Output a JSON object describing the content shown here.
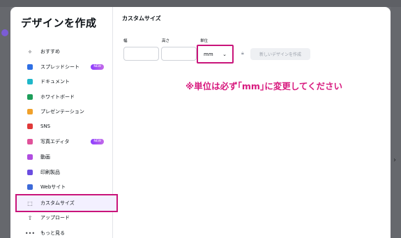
{
  "modal": {
    "title": "デザインを作成",
    "close_icon": "x-icon"
  },
  "sidebar": {
    "items": [
      {
        "label": "おすすめ",
        "icon": "sparkle-icon",
        "color": "#3b3d43"
      },
      {
        "label": "スプレッドシート",
        "icon": "spreadsheet-icon",
        "color": "#2f6fe4",
        "badge": "NEW"
      },
      {
        "label": "ドキュメント",
        "icon": "document-icon",
        "color": "#1fb7c9"
      },
      {
        "label": "ホワイトボード",
        "icon": "whiteboard-icon",
        "color": "#1e9e5a"
      },
      {
        "label": "プレゼンテーション",
        "icon": "presentation-icon",
        "color": "#f0a12b"
      },
      {
        "label": "SNS",
        "icon": "sns-icon",
        "color": "#e03a3a"
      },
      {
        "label": "写真エディタ",
        "icon": "photo-editor-icon",
        "color": "#e0529a",
        "badge": "NEW"
      },
      {
        "label": "動画",
        "icon": "video-icon",
        "color": "#b04de0"
      },
      {
        "label": "印刷製品",
        "icon": "print-icon",
        "color": "#6b4de0"
      },
      {
        "label": "Webサイト",
        "icon": "website-icon",
        "color": "#3d6ad8"
      },
      {
        "label": "カスタムサイズ",
        "icon": "custom-size-icon",
        "color": "#3b3d43"
      },
      {
        "label": "アップロード",
        "icon": "upload-icon",
        "color": "#3b3d43"
      },
      {
        "label": "もっと見る",
        "icon": "more-icon",
        "color": "#3b3d43"
      }
    ],
    "active_index": 10
  },
  "main": {
    "title": "カスタムサイズ",
    "width_label": "幅",
    "height_label": "高さ",
    "unit_label": "単位",
    "width_value": "",
    "height_value": "",
    "unit_value": "mm",
    "create_button": "新しいデザインを作成",
    "annotation": "※単位は必ず｢mm｣に変更してください"
  },
  "colors": {
    "accent": "#c9147a",
    "annotation": "#d81b7f",
    "active_bg": "#f3f0ff"
  }
}
